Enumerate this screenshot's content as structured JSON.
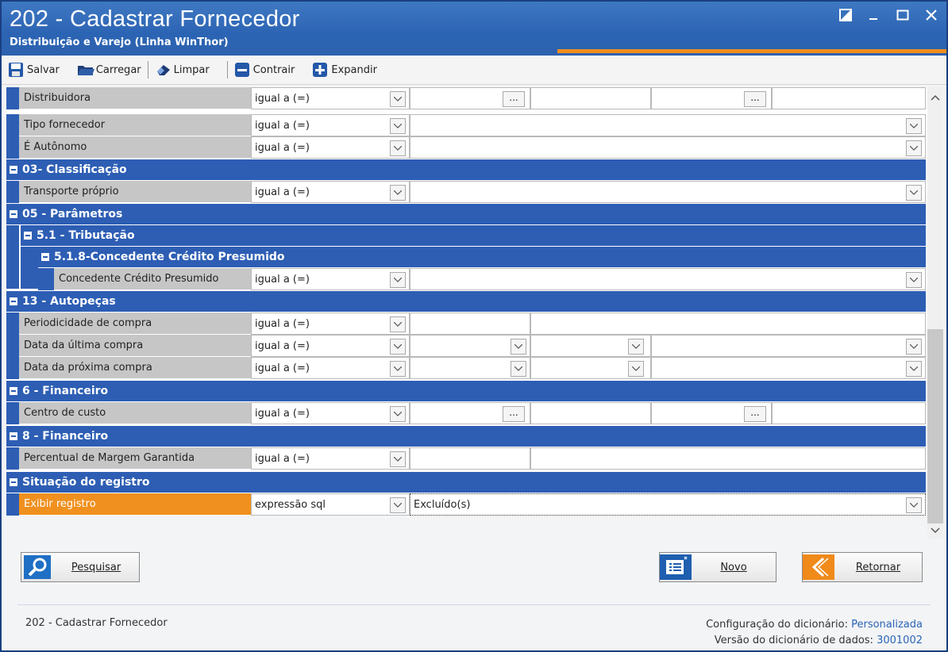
{
  "window": {
    "title": "202 - Cadastrar  Fornecedor",
    "subtitle": "Distribuição e Varejo (Linha WinThor)",
    "controls": [
      "restore-icon",
      "minimize-icon",
      "maximize-icon",
      "close-icon"
    ]
  },
  "toolbar": {
    "save": "Salvar",
    "load": "Carregar",
    "clear": "Limpar",
    "collapse": "Contrair",
    "expand": "Expandir"
  },
  "grid": {
    "rows": [
      {
        "label": "Distribuidora",
        "op": "igual a (=)",
        "kind": "range-ellipsis"
      },
      {
        "label": "Tipo fornecedor",
        "op": "igual a (=)",
        "kind": "dropdown"
      },
      {
        "label": "É Autônomo",
        "op": "igual a (=)",
        "kind": "dropdown"
      }
    ],
    "group_03": "03- Classificação",
    "row_transporte": {
      "label": "Transporte próprio",
      "op": "igual a (=)"
    },
    "group_05": "05 - Parâmetros",
    "group_51": "5.1 - Tributação",
    "group_518": "5.1.8-Concedente Crédito Presumido",
    "row_concedente": {
      "label": "Concedente Crédito Presumido",
      "op": "igual a (=)"
    },
    "group_13": "13 - Autopeças",
    "row_periodicidade": {
      "label": "Periodicidade de compra",
      "op": "igual a (=)"
    },
    "row_ultima": {
      "label": "Data da última compra",
      "op": "igual a (=)"
    },
    "row_proxima": {
      "label": "Data da próxima compra",
      "op": "igual a (=)"
    },
    "group_6": "6 - Financeiro",
    "row_centro": {
      "label": "Centro de custo",
      "op": "igual a (=)"
    },
    "group_8": "8 - Financeiro",
    "row_margem": {
      "label": "Percentual de Margem Garantida",
      "op": "igual a (=)"
    },
    "group_situacao": "Situação do registro",
    "row_exibir": {
      "label": "Exibir registro",
      "op": "expressão sql",
      "value": "Excluído(s)"
    },
    "ellipsis": "..."
  },
  "buttons": {
    "search": "Pesquisar",
    "new": "Novo",
    "back": "Retornar"
  },
  "footer": {
    "left": "202 - Cadastrar  Fornecedor",
    "config_label": "Configuração do dicionário:",
    "config_value": "Personalizada",
    "version_label": "Versão do dicionário de dados:",
    "version_value": "3001002"
  },
  "colors": {
    "title_bar": "#2c64b4",
    "group_header": "#2d5eb4",
    "label_cell": "#c6c6c6",
    "highlight": "#f0901e"
  }
}
